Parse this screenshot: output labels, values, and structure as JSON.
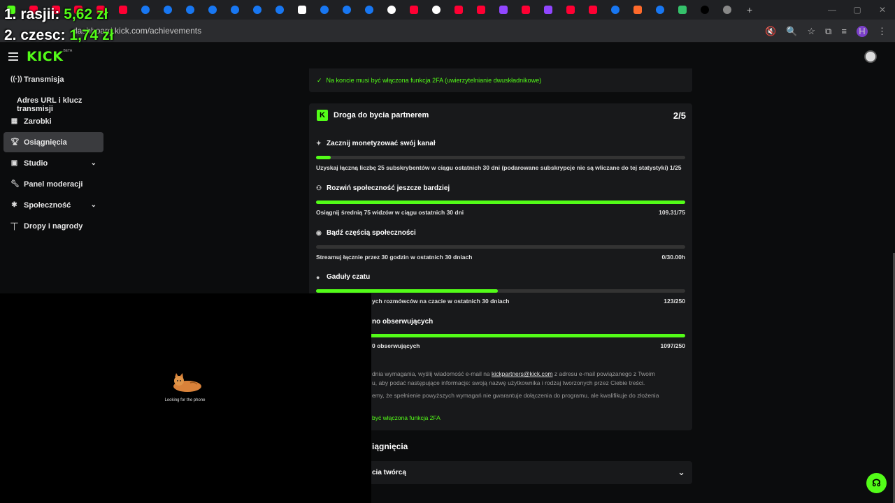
{
  "overlay": {
    "line1_label": "1. rasjii:",
    "line1_value": "5,62 zł",
    "line2_label": "2. czesc:",
    "line2_value": "1,74 zł"
  },
  "browser": {
    "url": "dashboard.kick.com/achievements",
    "profile_initial": "H",
    "tab_icons": [
      "kick-favicon",
      "youtube-favicon",
      "youtube-favicon",
      "youtube-favicon",
      "youtube-favicon",
      "youtube-favicon",
      "meta-favicon",
      "meta-favicon",
      "meta-favicon",
      "meta-favicon",
      "meta-favicon",
      "meta-favicon",
      "meta-favicon",
      "x-favicon",
      "meta-favicon",
      "meta-favicon",
      "meta-favicon",
      "google-favicon",
      "youtube-favicon",
      "google-favicon",
      "youtube-favicon",
      "youtube-favicon",
      "twitch-favicon",
      "youtube-favicon",
      "twitch-favicon",
      "youtube-favicon",
      "youtube-favicon",
      "meta-favicon",
      "orange-favicon",
      "meta-favicon",
      "green-favicon",
      "threads-favicon",
      "globe-favicon"
    ],
    "new_tab": "+"
  },
  "sidebar": {
    "brand": "KICK",
    "brand_tag": "BETA",
    "items": [
      {
        "label": "Transmisja",
        "icon": "broadcast-icon"
      },
      {
        "label": "Adres URL i klucz transmisji",
        "icon": ""
      },
      {
        "label": "Zarobki",
        "icon": "earnings-icon"
      },
      {
        "label": "Osiągnięcia",
        "icon": "trophy-icon",
        "active": true
      },
      {
        "label": "Studio",
        "icon": "studio-icon",
        "expandable": true
      },
      {
        "label": "Panel moderacji",
        "icon": "wrench-icon"
      },
      {
        "label": "Społeczność",
        "icon": "community-icon",
        "expandable": true
      },
      {
        "label": "Dropy i nagrody",
        "icon": "drops-icon"
      }
    ]
  },
  "top_card": {
    "check_text": "Na koncie musi być włączona funkcja 2FA (uwierzytelnianie dwuskładnikowe)"
  },
  "partner_card": {
    "title": "Droga do bycia partnerem",
    "count": "2/5",
    "requirements": [
      {
        "title": "Zacznij monetyzować swój kanał",
        "icon": "sparkle-icon",
        "desc": "Uzyskaj łączną liczbę 25 subskrybentów w ciągu ostatnich 30 dni (podarowane subskrypcje nie są wliczane do tej statystyki) 1/25",
        "value": "",
        "progress": 0.04
      },
      {
        "title": "Rozwiń społeczność jeszcze bardziej",
        "icon": "users-icon",
        "desc": "Osiągnij średnią 75 widzów w ciągu ostatnich 30 dni",
        "value": "109.31/75",
        "progress": 1.0
      },
      {
        "title": "Bądź częścią społeczności",
        "icon": "broadcast-icon",
        "desc": "Streamuj łącznie przez 30 godzin w ostatnich 30 dniach",
        "value": "0/30.00h",
        "progress": 0.0
      },
      {
        "title": "Gaduły czatu",
        "icon": "chat-icon",
        "desc": "ych rozmówców na czacie w ostatnich 30 dniach",
        "value": "123/250",
        "progress": 0.492
      },
      {
        "title": "no obserwujących",
        "icon": "",
        "desc": "0 obserwujących",
        "value": "1097/250",
        "progress": 1.0
      }
    ],
    "info_line1": "dnia wymagania, wyślij wiadomość e-mail na",
    "info_email": "kickpartners@kick.com",
    "info_line1_tail": "z adresu e-mail powiązanego z Twoim",
    "info_line2": "u, aby podać następujące informacje: swoją nazwę użytkownika i rodzaj tworzonych przez Ciebie treści.",
    "info_line3": "emy, że spełnienie powyższych wymagań nie gwarantuje dołączenia do programu, ale kwalifikuje do złożenia",
    "info_green": "być włączona funkcja 2FA"
  },
  "section": {
    "title": "iągnięcia",
    "accordion_label": "cia twórcą"
  },
  "webcam": {
    "caption": "Looking for the phone"
  },
  "colors": {
    "accent": "#53fc18",
    "background": "#0b0c0d",
    "card": "#18191b"
  }
}
